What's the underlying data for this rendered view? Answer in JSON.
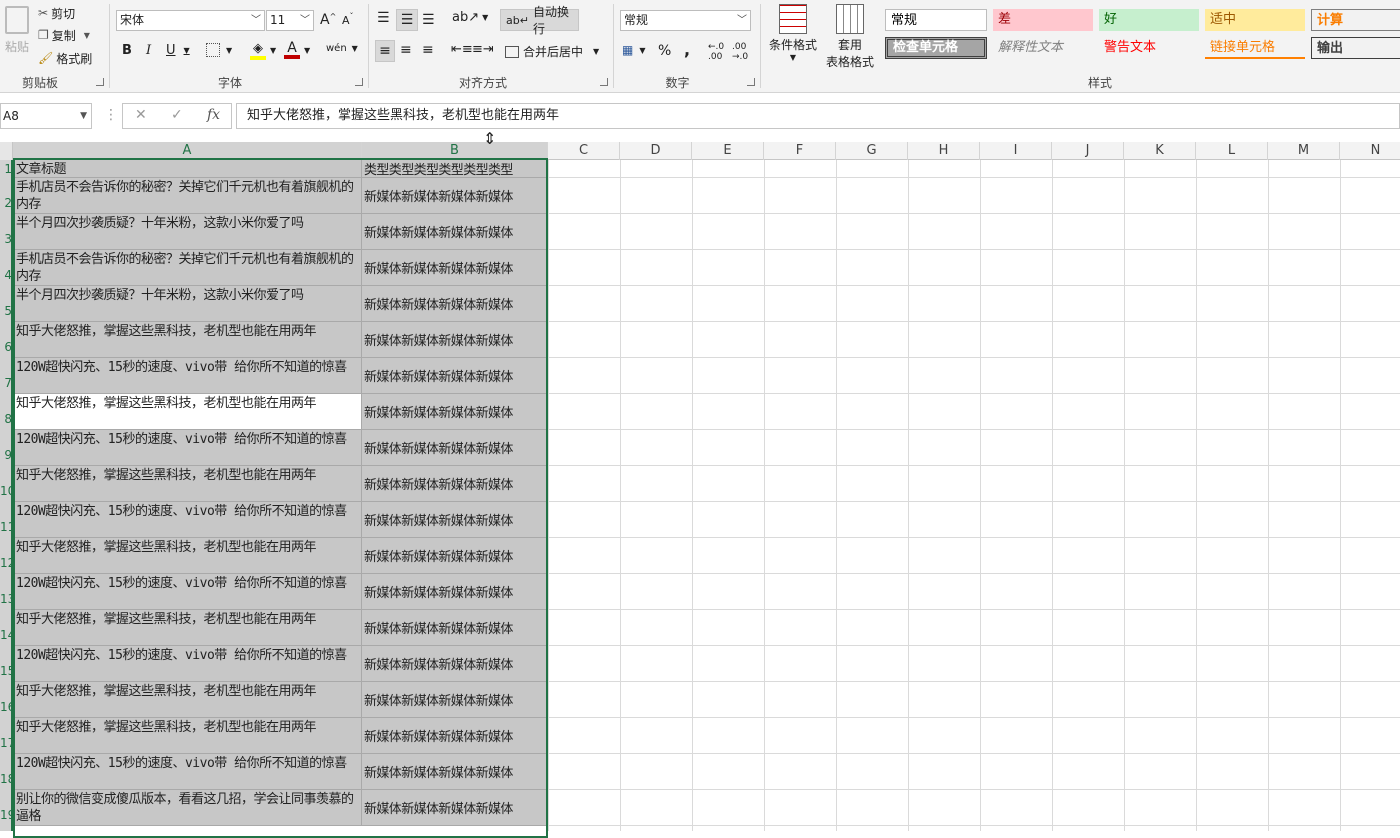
{
  "ribbon": {
    "clipboard": {
      "paste": "粘贴",
      "cut": "剪切",
      "copy": "复制",
      "format_painter": "格式刷",
      "group_label": "剪贴板"
    },
    "font": {
      "font_name": "宋体",
      "font_size": "11",
      "group_label": "字体",
      "bold": "B",
      "italic": "I",
      "underline": "U",
      "grow": "A",
      "shrink": "A",
      "font_color_letter": "A",
      "phonetic": "wén"
    },
    "alignment": {
      "wrap_text": "自动换行",
      "merge_center": "合并后居中",
      "group_label": "对齐方式"
    },
    "number": {
      "format": "常规",
      "percent": "%",
      "comma": ",",
      "group_label": "数字"
    },
    "styles": {
      "conditional_formatting": "条件格式",
      "format_as_table_1": "套用",
      "format_as_table_2": "表格格式",
      "group_label": "样式",
      "cell_styles": [
        {
          "label": "常规",
          "bg": "#ffffff",
          "fg": "#000000"
        },
        {
          "label": "差",
          "bg": "#ffc7ce",
          "fg": "#9c0006"
        },
        {
          "label": "好",
          "bg": "#c6efce",
          "fg": "#006100"
        },
        {
          "label": "适中",
          "bg": "#ffeb9c",
          "fg": "#9c5700"
        },
        {
          "label": "计算",
          "bg": "#f2f2f2",
          "fg": "#fa7d00"
        },
        {
          "label": "检查单元格",
          "bg": "#a5a5a5",
          "fg": "#ffffff"
        },
        {
          "label": "解释性文本",
          "bg": "#f3f3f3",
          "fg": "#7f7f7f"
        },
        {
          "label": "警告文本",
          "bg": "#f3f3f3",
          "fg": "#ff0000"
        },
        {
          "label": "链接单元格",
          "bg": "#f3f3f3",
          "fg": "#fa7d00"
        },
        {
          "label": "输出",
          "bg": "#f2f2f2",
          "fg": "#3f3f3f"
        }
      ]
    }
  },
  "formula_bar": {
    "name_box": "A8",
    "cancel": "✕",
    "enter": "✓",
    "fx": "fx",
    "content": "知乎大佬怒推，掌握这些黑科技，老机型也能在用两年"
  },
  "columns": [
    "A",
    "B",
    "C",
    "D",
    "E",
    "F",
    "G",
    "H",
    "I",
    "J",
    "K",
    "L",
    "M",
    "N"
  ],
  "accent": "#217346",
  "rows": [
    {
      "num": "1",
      "a": "文章标题",
      "b": "类型类型类型类型类型类型"
    },
    {
      "num": "2",
      "a": "手机店员不会告诉你的秘密？关掉它们千元机也有着旗舰机的内存",
      "b": "新媒体新媒体新媒体新媒体"
    },
    {
      "num": "3",
      "a": "半个月四次抄袭质疑？十年米粉，这款小米你爱了吗",
      "b": "新媒体新媒体新媒体新媒体"
    },
    {
      "num": "4",
      "a": "手机店员不会告诉你的秘密？关掉它们千元机也有着旗舰机的内存",
      "b": "新媒体新媒体新媒体新媒体"
    },
    {
      "num": "5",
      "a": "半个月四次抄袭质疑？十年米粉，这款小米你爱了吗",
      "b": "新媒体新媒体新媒体新媒体"
    },
    {
      "num": "6",
      "a": "知乎大佬怒推，掌握这些黑科技，老机型也能在用两年",
      "b": "新媒体新媒体新媒体新媒体"
    },
    {
      "num": "7",
      "a": "120W超快闪充、15秒的速度、vivo带 给你所不知道的惊喜",
      "b": "新媒体新媒体新媒体新媒体"
    },
    {
      "num": "8",
      "a": "知乎大佬怒推，掌握这些黑科技，老机型也能在用两年",
      "b": "新媒体新媒体新媒体新媒体"
    },
    {
      "num": "9",
      "a": "120W超快闪充、15秒的速度、vivo带 给你所不知道的惊喜",
      "b": "新媒体新媒体新媒体新媒体"
    },
    {
      "num": "10",
      "a": "知乎大佬怒推，掌握这些黑科技，老机型也能在用两年",
      "b": "新媒体新媒体新媒体新媒体"
    },
    {
      "num": "11",
      "a": "120W超快闪充、15秒的速度、vivo带 给你所不知道的惊喜",
      "b": "新媒体新媒体新媒体新媒体"
    },
    {
      "num": "12",
      "a": "知乎大佬怒推，掌握这些黑科技，老机型也能在用两年",
      "b": "新媒体新媒体新媒体新媒体"
    },
    {
      "num": "13",
      "a": "120W超快闪充、15秒的速度、vivo带 给你所不知道的惊喜",
      "b": "新媒体新媒体新媒体新媒体"
    },
    {
      "num": "14",
      "a": "知乎大佬怒推，掌握这些黑科技，老机型也能在用两年",
      "b": "新媒体新媒体新媒体新媒体"
    },
    {
      "num": "15",
      "a": "120W超快闪充、15秒的速度、vivo带 给你所不知道的惊喜",
      "b": "新媒体新媒体新媒体新媒体"
    },
    {
      "num": "16",
      "a": "知乎大佬怒推，掌握这些黑科技，老机型也能在用两年",
      "b": "新媒体新媒体新媒体新媒体"
    },
    {
      "num": "17",
      "a": "知乎大佬怒推，掌握这些黑科技，老机型也能在用两年",
      "b": "新媒体新媒体新媒体新媒体"
    },
    {
      "num": "18",
      "a": "120W超快闪充、15秒的速度、vivo带 给你所不知道的惊喜",
      "b": "新媒体新媒体新媒体新媒体"
    },
    {
      "num": "19",
      "a": "别让你的微信变成傻瓜版本，看看这几招，学会让同事羡慕的逼格",
      "b": "新媒体新媒体新媒体新媒体"
    }
  ],
  "active_row": "8"
}
